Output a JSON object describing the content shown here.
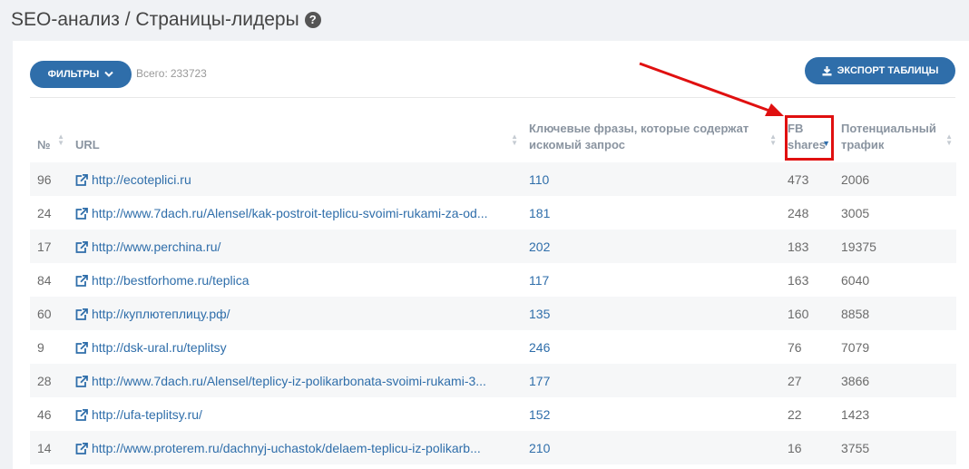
{
  "page": {
    "title": "SEO-анализ / Страницы-лидеры",
    "help": "?"
  },
  "toolbar": {
    "filters_label": "ФИЛЬТРЫ",
    "total_label": "Всего:",
    "total_value": "233723",
    "export_label": "ЭКСПОРТ ТАБЛИЦЫ"
  },
  "table": {
    "headers": {
      "num": "№",
      "url": "URL",
      "keywords": "Ключевые фразы, которые содержат искомый запрос",
      "fb_line1": "FB",
      "fb_line2": "shares",
      "traffic": "Потенциальный трафик"
    },
    "rows": [
      {
        "num": "96",
        "url": "http://ecoteplici.ru",
        "keywords": "110",
        "fb": "473",
        "traffic": "2006"
      },
      {
        "num": "24",
        "url": "http://www.7dach.ru/Alensel/kak-postroit-teplicu-svoimi-rukami-za-od...",
        "keywords": "181",
        "fb": "248",
        "traffic": "3005"
      },
      {
        "num": "17",
        "url": "http://www.perchina.ru/",
        "keywords": "202",
        "fb": "183",
        "traffic": "19375"
      },
      {
        "num": "84",
        "url": "http://bestforhome.ru/teplica",
        "keywords": "117",
        "fb": "163",
        "traffic": "6040"
      },
      {
        "num": "60",
        "url": "http://куплютеплицу.рф/",
        "keywords": "135",
        "fb": "160",
        "traffic": "8858"
      },
      {
        "num": "9",
        "url": "http://dsk-ural.ru/teplitsy",
        "keywords": "246",
        "fb": "76",
        "traffic": "7079"
      },
      {
        "num": "28",
        "url": "http://www.7dach.ru/Alensel/teplicy-iz-polikarbonata-svoimi-rukami-3...",
        "keywords": "177",
        "fb": "27",
        "traffic": "3866"
      },
      {
        "num": "46",
        "url": "http://ufa-teplitsy.ru/",
        "keywords": "152",
        "fb": "22",
        "traffic": "1423"
      },
      {
        "num": "14",
        "url": "http://www.proterem.ru/dachnyj-uchastok/delaem-teplicu-iz-polikarb...",
        "keywords": "210",
        "fb": "16",
        "traffic": "3755"
      }
    ]
  },
  "colors": {
    "accent": "#2f6eaa",
    "annotation": "#e01010"
  }
}
